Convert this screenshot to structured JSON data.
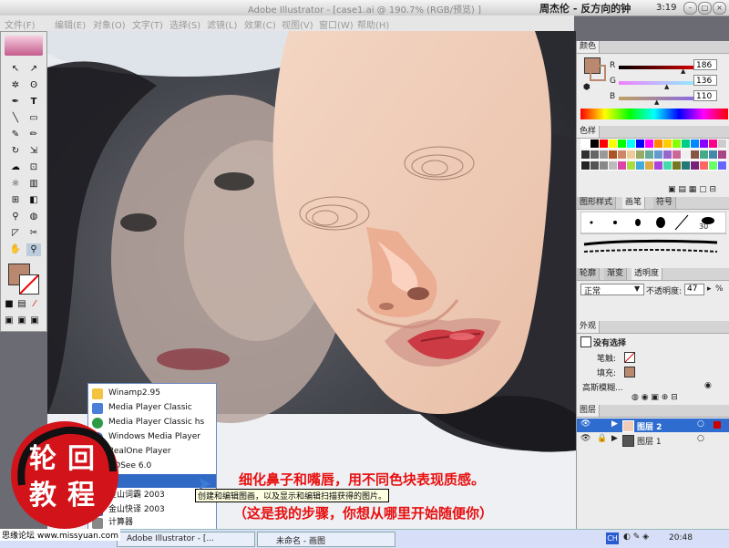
{
  "titlebar": {
    "app_title": "Adobe Illustrator - [case1.ai @ 190.7% (RGB/预览) ]",
    "song": "周杰伦 - 反方向的钟",
    "time": "3:19"
  },
  "menubar": {
    "items": [
      "文件(F)",
      "编辑(E)",
      "对象(O)",
      "文字(T)",
      "选择(S)",
      "滤镜(L)",
      "效果(C)",
      "视图(V)",
      "窗口(W)",
      "帮助(H)"
    ]
  },
  "color_panel": {
    "tab": "颜色",
    "r_label": "R",
    "g_label": "G",
    "b_label": "B",
    "r": "186",
    "g": "136",
    "b": "110",
    "fill_color": "#ba886e"
  },
  "swatches_panel": {
    "tab": "色样"
  },
  "brush_panel": {
    "tabs": [
      "图形样式",
      "画笔",
      "符号"
    ],
    "brush_size": "30"
  },
  "transparency_panel": {
    "tabs": [
      "轮廓",
      "渐变",
      "透明度"
    ],
    "mode": "正常",
    "opacity_label": "不透明度:",
    "opacity_value": "47",
    "percent": "%"
  },
  "appearance_panel": {
    "tab": "外观",
    "no_selection": "没有选择",
    "stroke_label": "笔触:",
    "fill_label": "填充:",
    "effect_label": "高斯模糊..."
  },
  "layers_panel": {
    "tab": "图层",
    "layers": [
      "图层 2",
      "图层 1"
    ]
  },
  "start_menu": {
    "items": [
      "Winamp2.95",
      "Media Player Classic",
      "Media Player Classic hs",
      "Windows Media Player",
      "RealOne Player",
      "ACDSee 6.0",
      "图",
      "金山词霸 2003",
      "金山快译 2003",
      "计算器"
    ],
    "tooltip": "创建和编辑图画，以及显示和编辑扫描获得的图片。"
  },
  "captions": {
    "line1": "细化鼻子和嘴唇，用不同色块表现质感。",
    "line2": "（这是我的步骤，你想从哪里开始随便你）"
  },
  "seal": {
    "chars": [
      "轮",
      "回",
      "教",
      "程"
    ],
    "site": "思缘论坛 www.missyuan.com"
  },
  "taskbar": {
    "task1": "Adobe Illustrator - [...",
    "task2": "未命名 - 画图",
    "lang": "CH",
    "clock": "20:48"
  },
  "colors": {
    "caption_red": "#e81010",
    "seal_red": "#d3131a",
    "face_skin": "#f0cdb8"
  }
}
